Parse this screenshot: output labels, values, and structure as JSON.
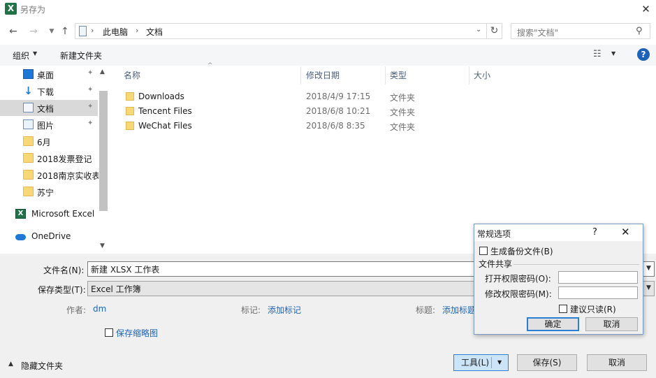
{
  "window": {
    "title": "另存为",
    "app_icon": "excel-icon",
    "close_glyph": "✕"
  },
  "address": {
    "crumbs": [
      "此电脑",
      "文档"
    ],
    "separator": "›",
    "search_placeholder": "搜索\"文档\""
  },
  "toolbar": {
    "organize": "组织",
    "new_folder": "新建文件夹"
  },
  "navigation": {
    "items": [
      {
        "label": "桌面",
        "icon": "desktop-icon",
        "pinned": true
      },
      {
        "label": "下载",
        "icon": "download-icon",
        "pinned": true
      },
      {
        "label": "文档",
        "icon": "document-icon",
        "pinned": true,
        "selected": true
      },
      {
        "label": "图片",
        "icon": "picture-icon",
        "pinned": true
      },
      {
        "label": "6月",
        "icon": "folder-icon"
      },
      {
        "label": "2018发票登记",
        "icon": "folder-icon"
      },
      {
        "label": "2018南京实收表",
        "icon": "folder-icon"
      },
      {
        "label": "苏宁",
        "icon": "folder-icon"
      },
      {
        "label": "Microsoft Excel",
        "icon": "excel-icon"
      },
      {
        "label": "OneDrive",
        "icon": "onedrive-icon"
      }
    ]
  },
  "filelist": {
    "columns": [
      "名称",
      "修改日期",
      "类型",
      "大小"
    ],
    "rows": [
      {
        "name": "Downloads",
        "date": "2018/4/9 17:15",
        "type": "文件夹"
      },
      {
        "name": "Tencent Files",
        "date": "2018/6/8 10:21",
        "type": "文件夹"
      },
      {
        "name": "WeChat Files",
        "date": "2018/6/8 8:35",
        "type": "文件夹"
      }
    ]
  },
  "form": {
    "filename_label": "文件名(N):",
    "filename_value": "新建 XLSX 工作表",
    "savetype_label": "保存类型(T):",
    "savetype_value": "Excel 工作簿",
    "author_label": "作者:",
    "author_value": "dm",
    "tags_label": "标记:",
    "tags_value": "添加标记",
    "title_label": "标题:",
    "title_value": "添加标题",
    "thumbnail_label": "保存缩略图",
    "thumbnail_checked": false,
    "hide_folders": "隐藏文件夹",
    "tools_button": "工具(L)",
    "save_button": "保存(S)",
    "cancel_button": "取消"
  },
  "options_dialog": {
    "title": "常规选项",
    "help": "?",
    "close": "✕",
    "backup_label": "生成备份文件(B)",
    "backup_checked": false,
    "sharing_group": "文件共享",
    "open_password_label": "打开权限密码(O):",
    "modify_password_label": "修改权限密码(M):",
    "readonly_label": "建议只读(R)",
    "readonly_checked": false,
    "ok_button": "确定",
    "cancel_button": "取消"
  },
  "colors": {
    "accent": "#1d64b8",
    "selection": "#d9d9d9",
    "folder": "#f8d775",
    "excel": "#1f7346"
  }
}
